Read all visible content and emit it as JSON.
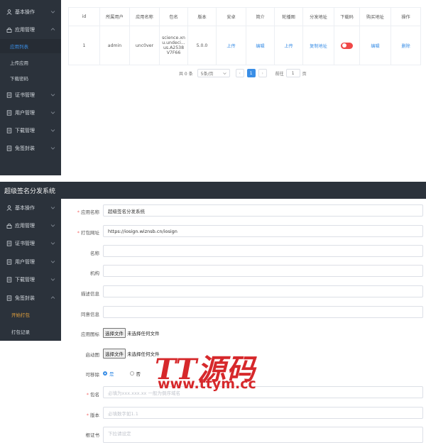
{
  "top": {
    "nav": [
      {
        "label": "基本操作",
        "icon": "user-icon"
      },
      {
        "label": "应用管理",
        "icon": "lock-icon"
      },
      {
        "label": "证书管理",
        "icon": "doc-icon"
      },
      {
        "label": "用户管理",
        "icon": "doc-icon"
      },
      {
        "label": "下载管理",
        "icon": "doc-icon"
      },
      {
        "label": "免签封装",
        "icon": "doc-icon"
      }
    ],
    "subnav": [
      "应用列表",
      "上传应用",
      "下载密码"
    ],
    "table": {
      "headers": [
        "id",
        "所属用户",
        "应用名称",
        "包名",
        "版本",
        "安卓",
        "简介",
        "轮播图",
        "分发地址",
        "下载码",
        "购买地址",
        "操作"
      ],
      "row": {
        "id": "1",
        "user": "admin",
        "app_name": "unc0ver",
        "bundle_line1": "science.xn",
        "bundle_line2": "u.undeci...",
        "bundle_line3": "us.A2538",
        "bundle_line4": "V7F66",
        "version": "5.0.0",
        "android": "上传",
        "intro": "编辑",
        "carousel": "上传",
        "dist_url": "复制地址",
        "buy_url": "编辑",
        "action": "删除"
      }
    },
    "pager": {
      "total": "共 0 条",
      "per_page": "5条/页",
      "prev": "‹",
      "page": "1",
      "next": "›",
      "goto": "前往",
      "goto_value": "1",
      "page_suffix": "页"
    }
  },
  "bottom": {
    "title": "超级签名分发系统",
    "nav": [
      {
        "label": "基本操作"
      },
      {
        "label": "应用管理"
      },
      {
        "label": "证书管理"
      },
      {
        "label": "用户管理"
      },
      {
        "label": "下载管理"
      },
      {
        "label": "免签封装"
      }
    ],
    "subnav": [
      "开始打包",
      "打包记录"
    ],
    "form": {
      "app_name_label": "应用名称",
      "app_name_value": "超级签名分发系统",
      "pack_url_label": "打包网址",
      "pack_url_value": "https://iosign.wiznsb.cn/iosign",
      "name_label": "名称",
      "org_label": "机构",
      "desc_label": "描述信息",
      "consent_label": "同意信息",
      "icon_label": "应用图标",
      "file_btn": "选择文件",
      "no_file": "未选择任何文件",
      "splash_label": "启动图",
      "removable_label": "可移除",
      "yes": "是",
      "no": "否",
      "bundle_label": "包名",
      "bundle_placeholder": "必填为xxx.xxx.xx 一般为倒序域名",
      "version_label": "版本",
      "version_placeholder": "必填数字如1.1",
      "cert_label": "根证书",
      "cert_placeholder": "下拉请设定"
    }
  },
  "watermark": {
    "line1": "TT源码",
    "line2": "www.ttym.cc"
  }
}
